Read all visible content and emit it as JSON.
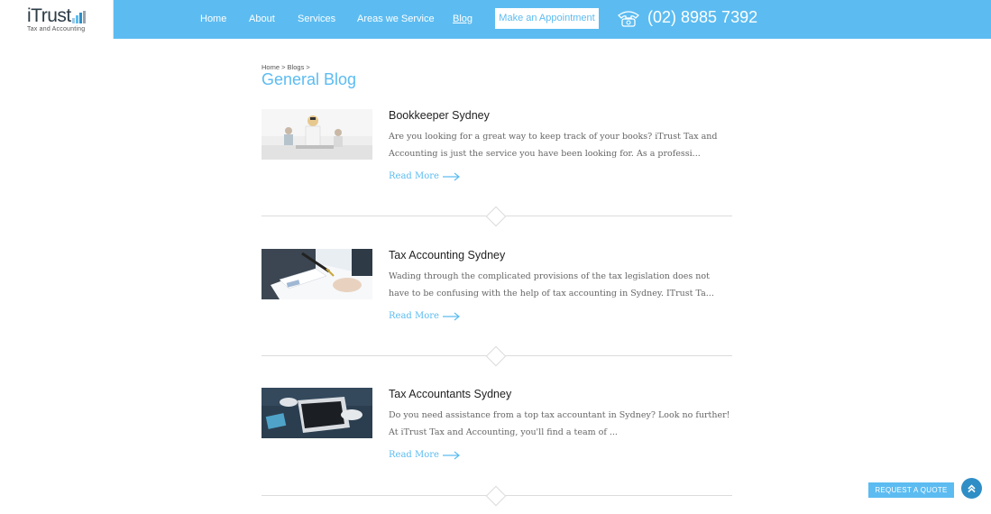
{
  "logo": {
    "name": "iTrust",
    "tagline": "Tax and Accounting"
  },
  "nav": {
    "items": [
      {
        "label": "Home",
        "active": false
      },
      {
        "label": "About",
        "active": false
      },
      {
        "label": "Services",
        "active": false
      },
      {
        "label": "Areas we Service",
        "active": false
      },
      {
        "label": "Blog",
        "active": true
      }
    ],
    "appointment_label": "Make an Appointment",
    "phone": "(02) 8985 7392"
  },
  "breadcrumb": "Home > Blogs >",
  "page_title": "General Blog",
  "posts": [
    {
      "title": "Bookkeeper Sydney",
      "excerpt": "Are you looking for a great way to keep track of your books? iTrust Tax and Accounting is just the service you have been looking for. As a professi...",
      "read_more": "Read More"
    },
    {
      "title": "Tax Accounting Sydney",
      "excerpt": "Wading through the complicated provisions of the tax legislation does not have to be confusing with the help of tax accounting in Sydney. ITrust Ta...",
      "read_more": "Read More"
    },
    {
      "title": "Tax Accountants Sydney",
      "excerpt": "Do you need assistance from a top tax accountant in Sydney?  Look no further!  At iTrust Tax and Accounting, you'll find a team of ...",
      "read_more": "Read More"
    }
  ],
  "floating": {
    "quote_label": "REQUEST A QUOTE",
    "top_icon": "double-chevron-up-icon"
  },
  "colors": {
    "accent": "#5cbcf1",
    "header_bg": "#5cbcf1",
    "top_button": "#2f8ec6"
  }
}
